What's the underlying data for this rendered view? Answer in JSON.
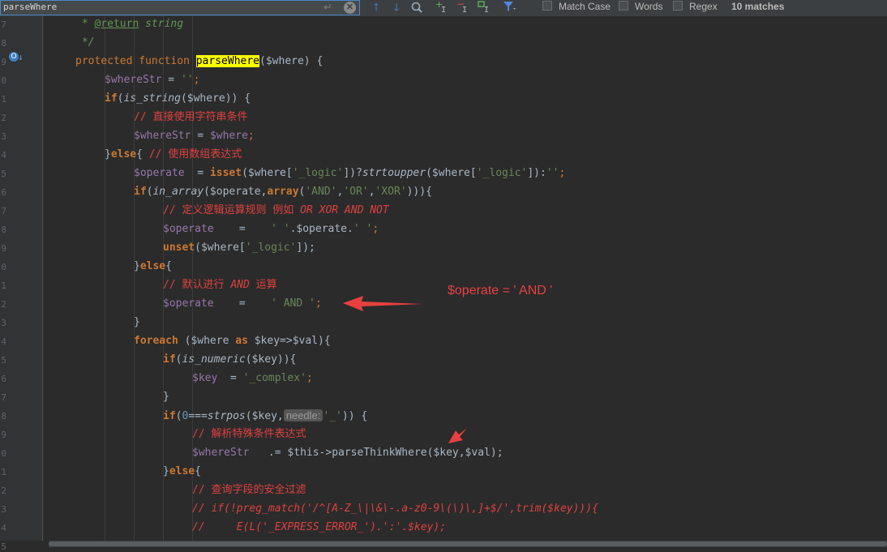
{
  "search": {
    "query": "parseWhere",
    "match_case_label": "Match Case",
    "words_label": "Words",
    "regex_label": "Regex",
    "matches_label": "10 matches"
  },
  "gutter": {
    "line_numbers": [
      "7",
      "8",
      "9",
      "0",
      "1",
      "2",
      "3",
      "4",
      "5",
      "6",
      "7",
      "8",
      "9",
      "0",
      "1",
      "2",
      "3",
      "4",
      "5",
      "6",
      "7",
      "8",
      "9",
      "0",
      "1",
      "2",
      "3",
      "4",
      "5"
    ]
  },
  "code": {
    "l1_star": " * ",
    "l1_tag": "@return",
    "l1_rest": " string",
    "l2": " */",
    "l3_kw1": "protected",
    "l3_kw2": "function",
    "l3_fn": "parseWhere",
    "l3_rest": "($where) {",
    "l4_var": "$whereStr",
    "l4_rest": " = ",
    "l4_str": "''",
    "l4_end": ";",
    "l5_kw": "if",
    "l5_fn": "is_string",
    "l5_rest": "($where)) {",
    "l6_cm": "// 直接使用字符串条件",
    "l7_a": "$whereStr",
    "l7_b": " = ",
    "l7_c": "$where",
    "l7_d": ";",
    "l8_a": "}",
    "l8_kw": "else",
    "l8_b": "{ ",
    "l8_cm": "// 使用数组表达式",
    "l9_a": "$operate",
    "l9_b": "  = ",
    "l9_kw": "isset",
    "l9_c": "($where[",
    "l9_s1": "'_logic'",
    "l9_d": "])?",
    "l9_fn": "strtoupper",
    "l9_e": "($where[",
    "l9_s2": "'_logic'",
    "l9_f": "]):",
    "l9_s3": "''",
    "l9_g": ";",
    "l10_kw": "if",
    "l10_fn": "in_array",
    "l10_a": "($operate,",
    "l10_kw2": "array",
    "l10_b": "(",
    "l10_s1": "'AND'",
    "l10_s2": "'OR'",
    "l10_s3": "'XOR'",
    "l10_c": "))){",
    "l11_cm": "// 定义逻辑运算规则 例如 ",
    "l11_cmi": "OR XOR AND NOT",
    "l12_a": "$operate",
    "l12_b": "    =    ",
    "l12_s1": "' '",
    "l12_c": ".$operate.",
    "l12_s2": "' '",
    "l12_d": ";",
    "l13_kw": "unset",
    "l13_a": "($where[",
    "l13_s": "'_logic'",
    "l13_b": "]);",
    "l14_a": "}",
    "l14_kw": "else",
    "l14_b": "{",
    "l15_cm": "// 默认进行 ",
    "l15_cmi": "AND",
    "l15_cm2": " 运算",
    "l16_a": "$operate",
    "l16_b": "    =    ",
    "l16_s": "' AND '",
    "l16_c": ";",
    "l17": "}",
    "l18_kw": "foreach",
    "l18_a": " ($where ",
    "l18_kw2": "as",
    "l18_b": " $key=>$val){",
    "l19_kw": "if",
    "l19_fn": "is_numeric",
    "l19_a": "($key)){",
    "l20_a": "$key",
    "l20_b": "  = ",
    "l20_s": "'_complex'",
    "l20_c": ";",
    "l21": "}",
    "l22_kw": "if",
    "l22_a": "(",
    "l22_num": "0",
    "l22_b": "===",
    "l22_fn": "strpos",
    "l22_c": "($key,",
    "l22_hint": "needle:",
    "l22_s": "'_'",
    "l22_d": ")) {",
    "l23_cm": "// 解析特殊条件表达式",
    "l24_a": "$whereStr",
    "l24_b": "   .= $this->parseThinkWhere($key,$val);",
    "l25_a": "}",
    "l25_kw": "else",
    "l25_b": "{",
    "l26_cm": "// 查询字段的安全过滤",
    "l27_cm": "// if(!preg_match('/^[A-Z_\\|\\&\\-.a-z0-9\\(\\)\\,]+$/',trim($key))){",
    "l28_cm": "//     E(L('_EXPRESS_ERROR_').':'.$key);",
    "l29_cm": "// }"
  },
  "annotation": {
    "text": "$operate = ' AND '",
    "color": "#e84040"
  },
  "colors": {
    "background": "#2b2b2b",
    "keyword": "#cc7832",
    "string": "#6a8759",
    "variable": "#9876aa",
    "comment": "#e04040",
    "highlight": "#ffff00"
  }
}
